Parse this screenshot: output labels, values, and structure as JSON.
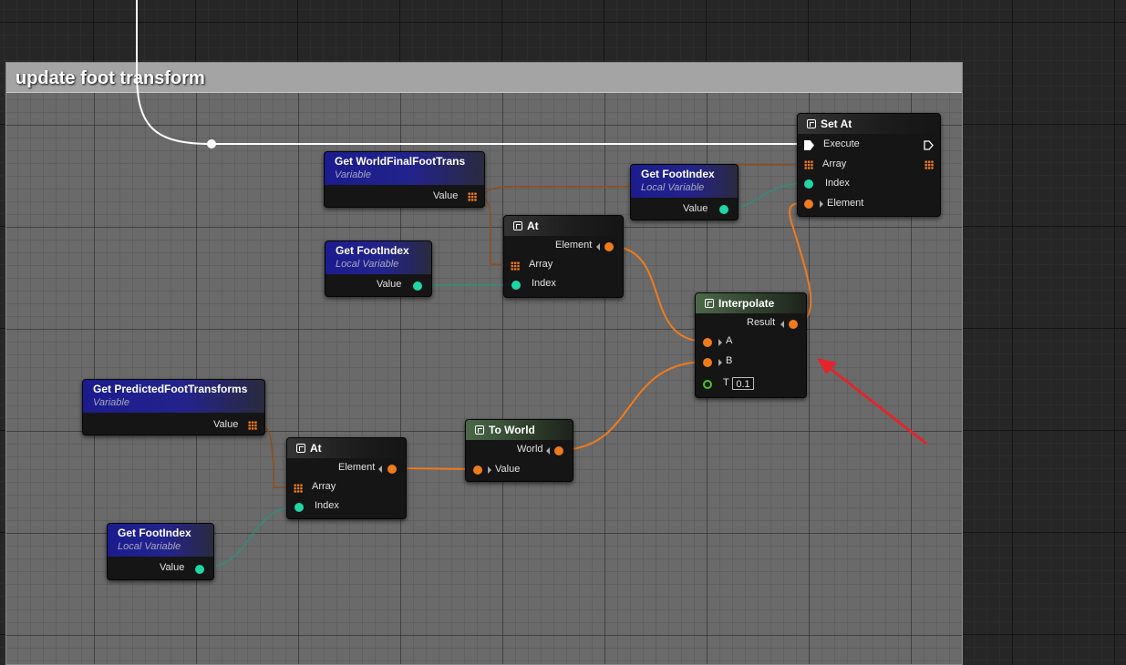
{
  "comment": {
    "title": "update foot transform"
  },
  "colors": {
    "exec": "#ffffff",
    "struct_pin": "#f07b1d",
    "int_pin": "#1fd7a6",
    "float_pin": "#49c81b",
    "variable_header": "#1b1b8e",
    "pure_function_header": "#4b6848",
    "annotation_arrow": "#e3242b"
  },
  "nodes": {
    "set_at": {
      "title": "Set At",
      "icon": "function-icon",
      "pins": {
        "execute": "Execute",
        "array": "Array",
        "index": "Index",
        "element": "Element"
      }
    },
    "get_world_final_foot_trans": {
      "title": "Get WorldFinalFootTrans",
      "subtitle": "Variable",
      "output": "Value"
    },
    "get_foot_index_1": {
      "title": "Get FootIndex",
      "subtitle": "Local Variable",
      "output": "Value"
    },
    "at_1": {
      "title": "At",
      "icon": "function-icon",
      "pins": {
        "element": "Element",
        "array": "Array",
        "index": "Index"
      }
    },
    "get_foot_index_2": {
      "title": "Get FootIndex",
      "subtitle": "Local Variable",
      "output": "Value"
    },
    "interpolate": {
      "title": "Interpolate",
      "icon": "function-icon",
      "pins": {
        "result": "Result",
        "a": "A",
        "b": "B",
        "t": "T"
      },
      "t_value": "0.1"
    },
    "get_predicted_foot_transforms": {
      "title": "Get PredictedFootTransforms",
      "subtitle": "Variable",
      "output": "Value"
    },
    "at_2": {
      "title": "At",
      "icon": "function-icon",
      "pins": {
        "element": "Element",
        "array": "Array",
        "index": "Index"
      }
    },
    "to_world": {
      "title": "To World",
      "icon": "function-icon",
      "pins": {
        "world": "World",
        "value": "Value"
      }
    },
    "get_foot_index_3": {
      "title": "Get FootIndex",
      "subtitle": "Local Variable",
      "output": "Value"
    }
  }
}
